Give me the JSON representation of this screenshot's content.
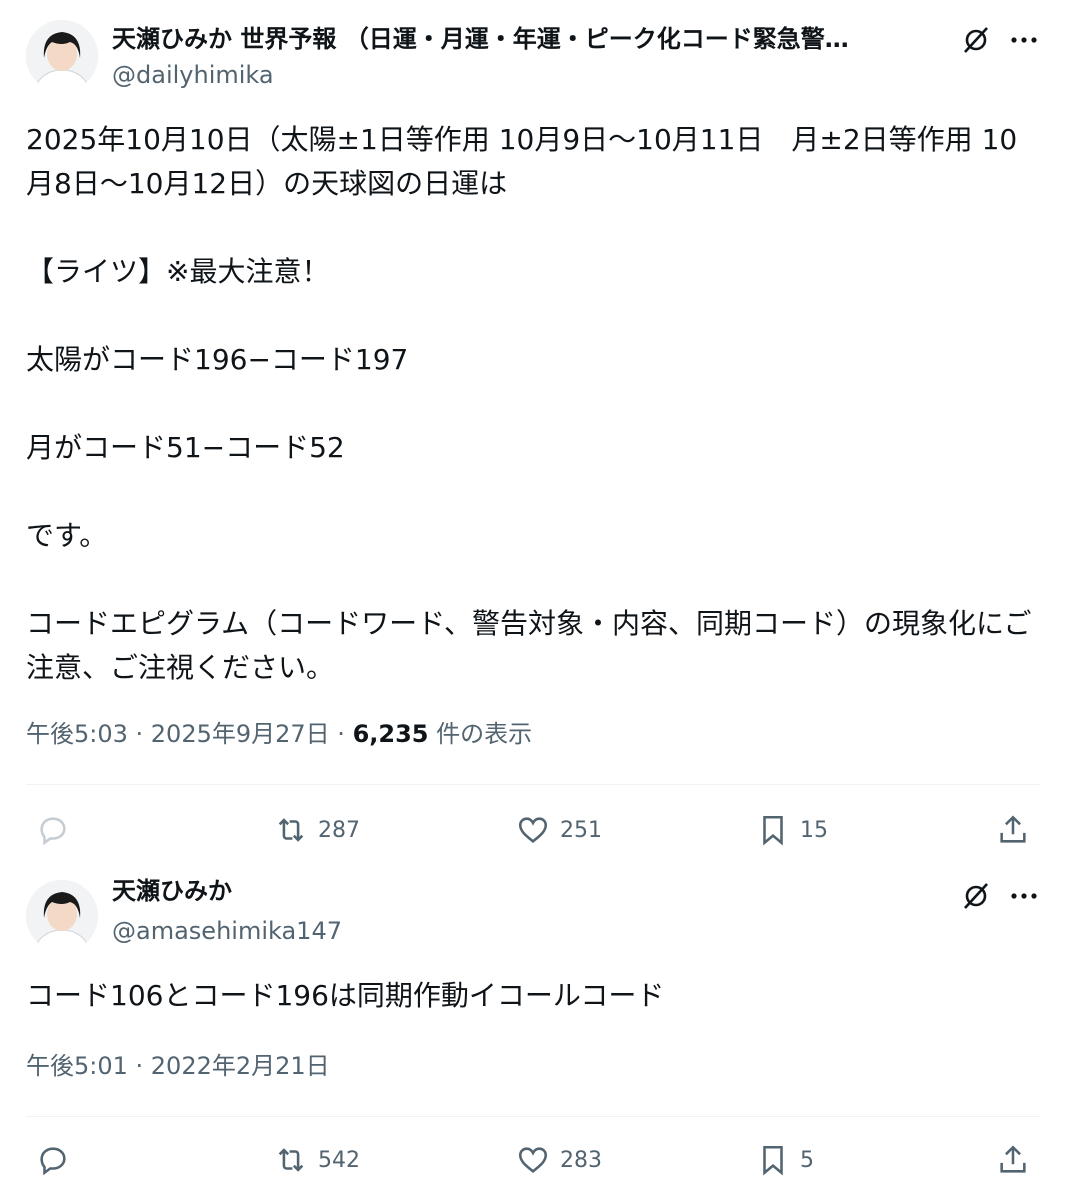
{
  "posts": [
    {
      "author": {
        "name": "天瀬ひみか 世界予報 （日運・月運・年運・ピーク化コード緊急警…",
        "handle": "@dailyhimika"
      },
      "body": "2025年10月10日（太陽±1日等作用 10月9日〜10月11日　月±2日等作用 10月8日〜10月12日）の天球図の日運は\n\n【ライツ】※最大注意！\n\n太陽がコード196−コード197\n\n月がコード51−コード52\n\nです。\n\nコードエピグラム（コードワード、警告対象・内容、同期コード）の現象化にご注意、ご注視ください。",
      "timestamp": "午後5:03 · 2025年9月27日 · ",
      "views_count": "6,235",
      "views_label": " 件の表示",
      "actions": {
        "reply_count": "",
        "repost_count": "287",
        "like_count": "251",
        "bookmark_count": "15"
      }
    },
    {
      "author": {
        "name": "天瀬ひみか",
        "handle": "@amasehimika147"
      },
      "body": "コード106とコード196は同期作動イコールコード",
      "timestamp": "午後5:01 · 2022年2月21日",
      "actions": {
        "reply_count": "",
        "repost_count": "542",
        "like_count": "283",
        "bookmark_count": "5"
      }
    }
  ],
  "icons": {
    "reply": "reply-icon",
    "repost": "repost-icon",
    "like": "heart-icon",
    "bookmark": "bookmark-icon",
    "share": "share-icon",
    "grok": "grok-icon",
    "more": "more-icon"
  },
  "colors": {
    "text": "#0f1419",
    "secondary": "#536471",
    "divider": "#eff3f4"
  }
}
